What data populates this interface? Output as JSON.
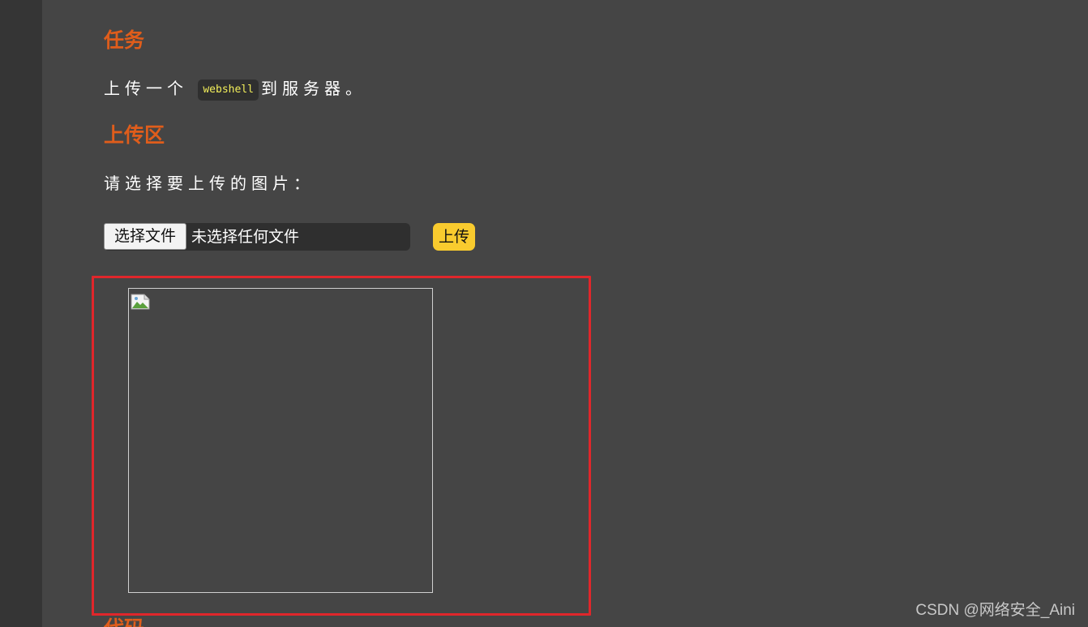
{
  "task": {
    "heading": "任务",
    "text_before": "上传一个",
    "code": "webshell",
    "text_after": "到服务器。"
  },
  "upload": {
    "heading": "上传区",
    "prompt": "请选择要上传的图片：",
    "choose_button_label": "选择文件",
    "no_file_text": "未选择任何文件",
    "submit_button_label": "上传"
  },
  "preview": {
    "icon": "broken-image-icon"
  },
  "code_section": {
    "heading": "代码"
  },
  "watermark": {
    "text": "CSDN @网络安全_Aini"
  },
  "colors": {
    "background": "#454545",
    "heading_accent": "#e05d1b",
    "submit_button": "#f9cb2e",
    "highlight_border": "#e0262b",
    "code_text": "#f2ee5a"
  }
}
